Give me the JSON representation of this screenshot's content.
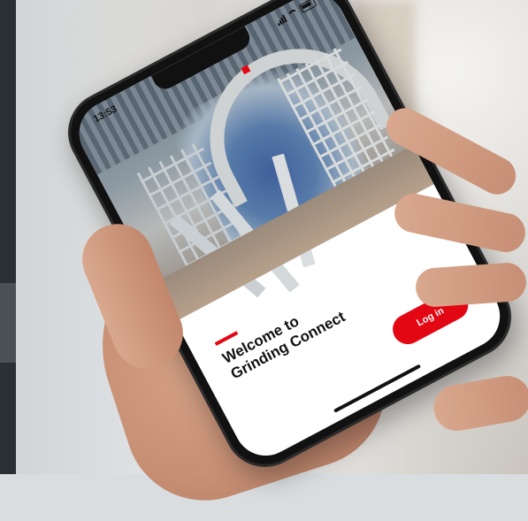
{
  "status_bar": {
    "time": "13:53"
  },
  "welcome": {
    "title": "Welcome to\nGrinding Connect"
  },
  "actions": {
    "login_label": "Log in"
  },
  "colors": {
    "accent": "#e30613",
    "text": "#111111",
    "background": "#ffffff"
  },
  "icons": [
    "signal-icon",
    "wifi-icon",
    "battery-icon"
  ]
}
